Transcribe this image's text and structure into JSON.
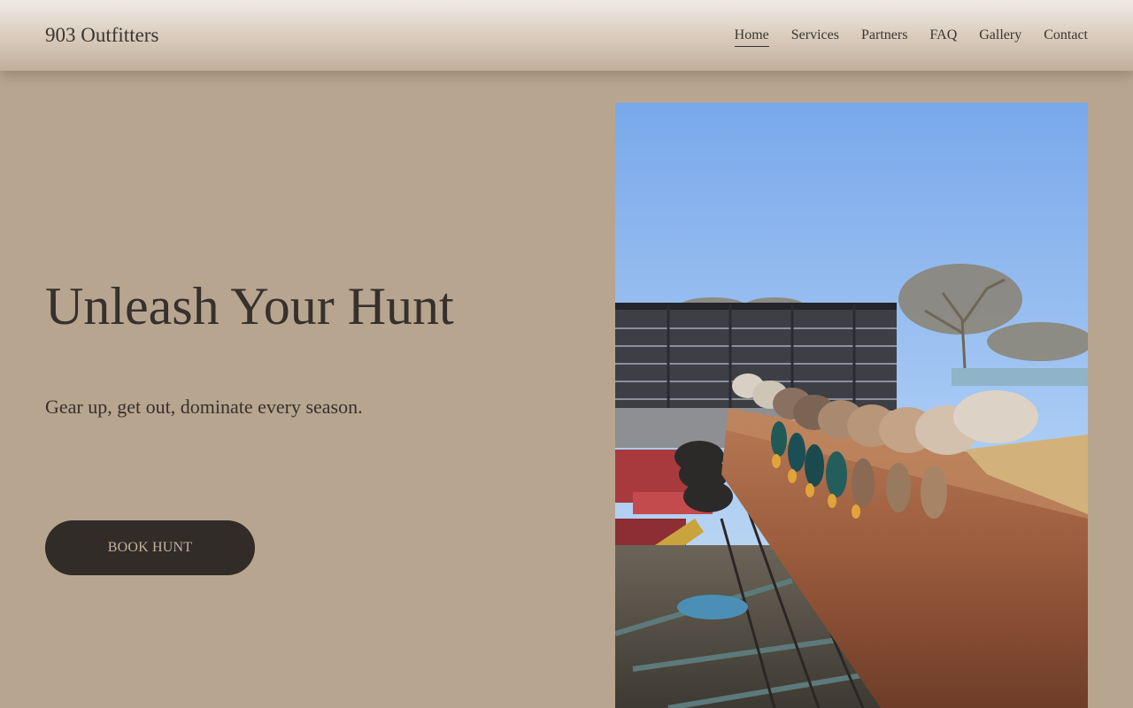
{
  "site": {
    "brand": "903 Outfitters"
  },
  "nav": {
    "items": [
      {
        "label": "Home",
        "active": true
      },
      {
        "label": "Services",
        "active": false
      },
      {
        "label": "Partners",
        "active": false
      },
      {
        "label": "FAQ",
        "active": false
      },
      {
        "label": "Gallery",
        "active": false
      },
      {
        "label": "Contact",
        "active": false
      }
    ]
  },
  "hero": {
    "title": "Unleash Your Hunt",
    "subtitle": "Gear up, get out, dominate every season.",
    "cta_label": "BOOK HUNT",
    "image_subject": "mallard ducks lined up on a rusty farm implement under a clear blue sky"
  },
  "colors": {
    "page_background": "#b8a590",
    "header_top": "#efebe5",
    "header_bottom": "#c2af9a",
    "text_dark": "#36312c",
    "button_background": "#312c27",
    "button_text": "#c6b39e"
  }
}
